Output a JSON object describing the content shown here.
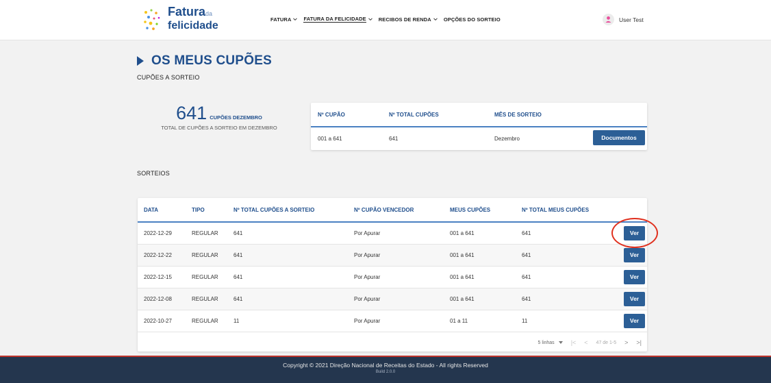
{
  "brand": {
    "line1": "Fatura",
    "line1_small": "da",
    "line2": "felicidade",
    "color": "#1f4e8c"
  },
  "nav": {
    "items": [
      {
        "label": "FATURA",
        "has_dropdown": true
      },
      {
        "label": "FATURA DA FELICIDADE",
        "has_dropdown": true,
        "active": true
      },
      {
        "label": "RECIBOS DE RENDA",
        "has_dropdown": true
      },
      {
        "label": "OPÇÕES DO SORTEIO",
        "has_dropdown": false
      }
    ]
  },
  "user": {
    "name": "User Test",
    "icon": "user-avatar-icon"
  },
  "page": {
    "title": "OS MEUS CUPÕES",
    "coupons_section": "CUPÕES A SORTEIO",
    "draws_section": "SORTEIOS"
  },
  "summary": {
    "count": "641",
    "unit": "CUPÕES DEZEMBRO",
    "caption": "TOTAL DE CUPÕES A SORTEIO EM DEZEMBRO"
  },
  "coupons_table": {
    "headers": [
      "Nº CUPÃO",
      "Nº TOTAL CUPÕES",
      "MÊS DE SORTEIO"
    ],
    "row": [
      "001 a 641",
      "641",
      "Dezembro"
    ],
    "button": "Documentos"
  },
  "draws_table": {
    "headers": [
      "DATA",
      "TIPO",
      "Nº TOTAL CUPÕES A SORTEIO",
      "Nº CUPÃO VENCEDOR",
      "MEUS CUPÕES",
      "Nº TOTAL MEUS CUPÕES"
    ],
    "rows": [
      [
        "2022-12-29",
        "REGULAR",
        "641",
        "Por Apurar",
        "001 a 641",
        "641"
      ],
      [
        "2022-12-22",
        "REGULAR",
        "641",
        "Por Apurar",
        "001 a 641",
        "641"
      ],
      [
        "2022-12-15",
        "REGULAR",
        "641",
        "Por Apurar",
        "001 a 641",
        "641"
      ],
      [
        "2022-12-08",
        "REGULAR",
        "641",
        "Por Apurar",
        "001 a 641",
        "641"
      ],
      [
        "2022-10-27",
        "REGULAR",
        "11",
        "Por Apurar",
        "01 a 11",
        "11"
      ]
    ],
    "row_button": "Ver",
    "pagination": {
      "rows_per_page": "5 linhas",
      "range": "47 de 1-5"
    }
  },
  "footer": {
    "copyright": "Copyright © 2021 Direção Nacional de Receitas do Estado - All rights Reserved",
    "build": "Build 2.0.0"
  },
  "colors": {
    "primary": "#1f4e8c",
    "button": "#2c5f96",
    "footer": "#24364e",
    "highlight": "#e0301e"
  }
}
